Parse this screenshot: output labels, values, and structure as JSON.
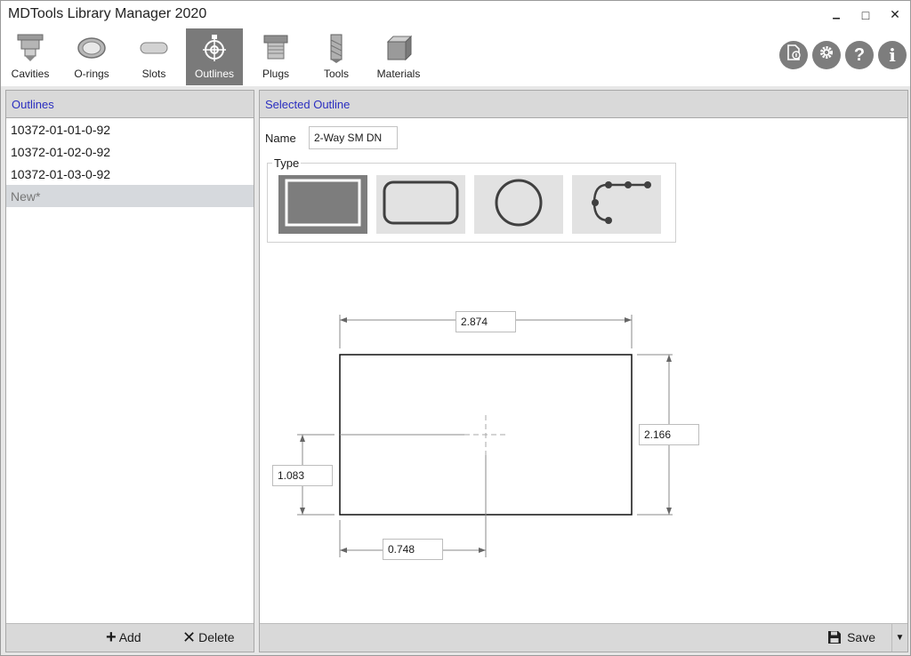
{
  "window": {
    "title": "MDTools Library Manager 2020",
    "minimize_glyph": "▁",
    "maximize_glyph": "□",
    "close_glyph": "✕"
  },
  "toolbar": {
    "items": [
      {
        "label": "Cavities",
        "icon": "cavity-icon"
      },
      {
        "label": "O-rings",
        "icon": "o-ring-icon"
      },
      {
        "label": "Slots",
        "icon": "slot-icon"
      },
      {
        "label": "Outlines",
        "icon": "outline-icon",
        "active": true
      },
      {
        "label": "Plugs",
        "icon": "plug-icon"
      },
      {
        "label": "Tools",
        "icon": "tool-icon"
      },
      {
        "label": "Materials",
        "icon": "material-icon"
      }
    ],
    "right_buttons": [
      "import-file-icon",
      "gear-icon",
      "help-icon",
      "info-icon"
    ],
    "help_glyph": "?",
    "info_glyph": "i"
  },
  "outlines_panel": {
    "header": "Outlines",
    "items": [
      "10372-01-01-0-92",
      "10372-01-02-0-92",
      "10372-01-03-0-92"
    ],
    "new_item": "New*",
    "add_label": "Add",
    "delete_label": "Delete",
    "add_glyph": "+",
    "delete_glyph": "✕"
  },
  "selected_outline": {
    "header": "Selected Outline",
    "name_label": "Name",
    "name_value": "2-Way SM DN",
    "type_label": "Type",
    "shapes": [
      "rectangle",
      "rounded-rectangle",
      "circle",
      "polyline"
    ],
    "selected_shape": "rectangle",
    "dimensions": {
      "width": "2.874",
      "height": "2.166",
      "center_y": "1.083",
      "center_x": "0.748"
    },
    "save_label": "Save",
    "dropdown_glyph": "▼"
  },
  "colors": {
    "accent_text": "#2a2ec0",
    "active_tab": "#7a7a7a",
    "header_bg": "#d9d9d9"
  }
}
